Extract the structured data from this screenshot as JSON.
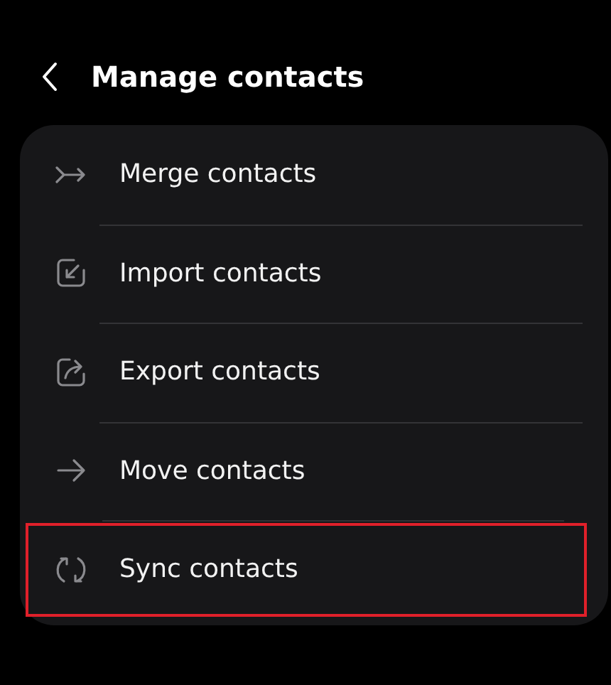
{
  "header": {
    "title": "Manage contacts"
  },
  "items": [
    {
      "label": "Merge contacts",
      "kind": "merge",
      "highlighted": false
    },
    {
      "label": "Import contacts",
      "kind": "import",
      "highlighted": false
    },
    {
      "label": "Export contacts",
      "kind": "export",
      "highlighted": false
    },
    {
      "label": "Move contacts",
      "kind": "move",
      "highlighted": false
    },
    {
      "label": "Sync contacts",
      "kind": "sync",
      "highlighted": true
    }
  ]
}
